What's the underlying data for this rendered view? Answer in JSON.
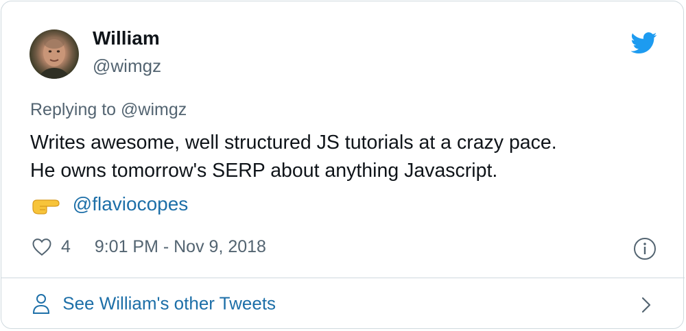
{
  "tweet": {
    "author_name": "William",
    "author_handle": "@wimgz",
    "replying_prefix": "Replying to",
    "replying_handle": "@wimgz",
    "text_lines": [
      "Writes awesome, well structured JS tutorials at a crazy pace.",
      "He owns tomorrow's SERP about anything Javascript."
    ],
    "mention": "@flaviocopes",
    "like_count": "4",
    "timestamp": "9:01 PM - Nov 9, 2018",
    "other_tweets_label": "See William's other Tweets"
  },
  "icons": {
    "brand": "twitter-bird-icon",
    "emoji": "backhand-index-pointing-right-icon",
    "like": "heart-icon",
    "info": "info-icon",
    "profile": "person-icon",
    "chevron": "chevron-right-icon"
  },
  "colors": {
    "brand_blue": "#1d9bf0",
    "link_blue": "#1d6fa8",
    "text": "#0f1419",
    "secondary_text": "#536471",
    "border": "#cfd9de"
  }
}
